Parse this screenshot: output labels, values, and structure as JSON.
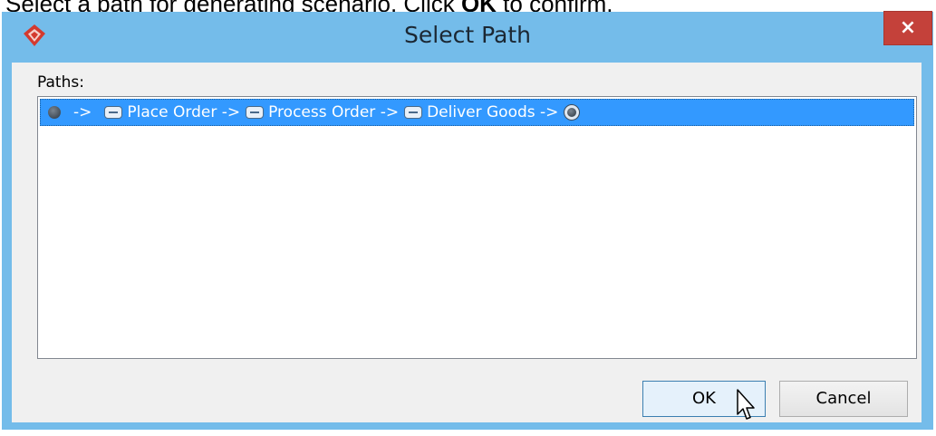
{
  "instruction": {
    "prefix": "Select a path for generating scenario. Click ",
    "bold": "OK",
    "suffix": " to confirm."
  },
  "window": {
    "title": "Select Path",
    "close_glyph": "×",
    "app_icon": "visual-paradigm-logo-icon",
    "colors": {
      "titlebar": "#74bcea",
      "close": "#c4413a",
      "selection": "#3399ff"
    }
  },
  "paths": {
    "label": "Paths:",
    "selected_row": {
      "start_arrow": "->",
      "steps": [
        {
          "label": "Place Order ->"
        },
        {
          "label": "Process Order ->"
        },
        {
          "label": "Deliver Goods ->"
        }
      ]
    }
  },
  "buttons": {
    "ok": "OK",
    "cancel": "Cancel"
  }
}
